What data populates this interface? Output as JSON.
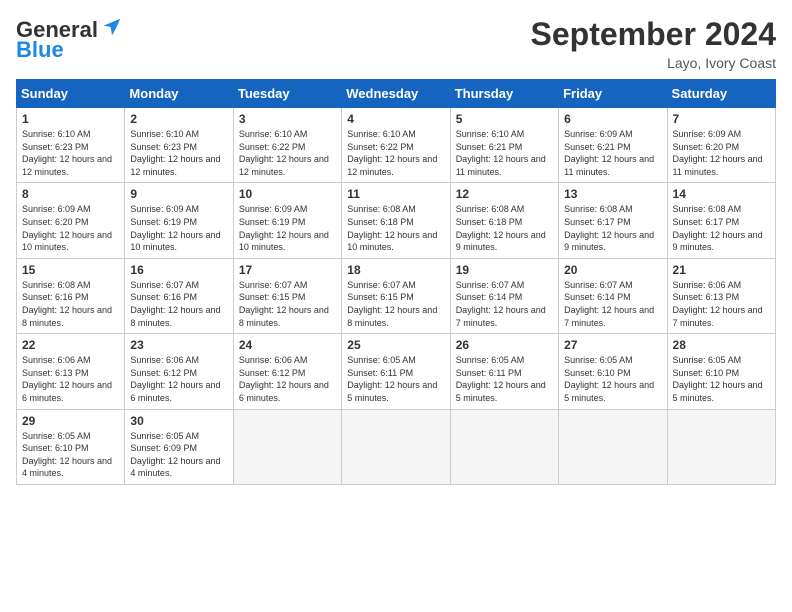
{
  "header": {
    "logo_general": "General",
    "logo_blue": "Blue",
    "month_title": "September 2024",
    "location": "Layo, Ivory Coast"
  },
  "calendar": {
    "days_of_week": [
      "Sunday",
      "Monday",
      "Tuesday",
      "Wednesday",
      "Thursday",
      "Friday",
      "Saturday"
    ],
    "weeks": [
      [
        {
          "day": "",
          "empty": true
        },
        {
          "day": "",
          "empty": true
        },
        {
          "day": "",
          "empty": true
        },
        {
          "day": "",
          "empty": true
        },
        {
          "day": "",
          "empty": true
        },
        {
          "day": "",
          "empty": true
        },
        {
          "day": "",
          "empty": true
        }
      ],
      [
        {
          "day": "1",
          "sunrise": "6:10 AM",
          "sunset": "6:23 PM",
          "daylight": "12 hours and 12 minutes."
        },
        {
          "day": "2",
          "sunrise": "6:10 AM",
          "sunset": "6:23 PM",
          "daylight": "12 hours and 12 minutes."
        },
        {
          "day": "3",
          "sunrise": "6:10 AM",
          "sunset": "6:22 PM",
          "daylight": "12 hours and 12 minutes."
        },
        {
          "day": "4",
          "sunrise": "6:10 AM",
          "sunset": "6:22 PM",
          "daylight": "12 hours and 12 minutes."
        },
        {
          "day": "5",
          "sunrise": "6:10 AM",
          "sunset": "6:21 PM",
          "daylight": "12 hours and 11 minutes."
        },
        {
          "day": "6",
          "sunrise": "6:09 AM",
          "sunset": "6:21 PM",
          "daylight": "12 hours and 11 minutes."
        },
        {
          "day": "7",
          "sunrise": "6:09 AM",
          "sunset": "6:20 PM",
          "daylight": "12 hours and 11 minutes."
        }
      ],
      [
        {
          "day": "8",
          "sunrise": "6:09 AM",
          "sunset": "6:20 PM",
          "daylight": "12 hours and 10 minutes."
        },
        {
          "day": "9",
          "sunrise": "6:09 AM",
          "sunset": "6:19 PM",
          "daylight": "12 hours and 10 minutes."
        },
        {
          "day": "10",
          "sunrise": "6:09 AM",
          "sunset": "6:19 PM",
          "daylight": "12 hours and 10 minutes."
        },
        {
          "day": "11",
          "sunrise": "6:08 AM",
          "sunset": "6:18 PM",
          "daylight": "12 hours and 10 minutes."
        },
        {
          "day": "12",
          "sunrise": "6:08 AM",
          "sunset": "6:18 PM",
          "daylight": "12 hours and 9 minutes."
        },
        {
          "day": "13",
          "sunrise": "6:08 AM",
          "sunset": "6:17 PM",
          "daylight": "12 hours and 9 minutes."
        },
        {
          "day": "14",
          "sunrise": "6:08 AM",
          "sunset": "6:17 PM",
          "daylight": "12 hours and 9 minutes."
        }
      ],
      [
        {
          "day": "15",
          "sunrise": "6:08 AM",
          "sunset": "6:16 PM",
          "daylight": "12 hours and 8 minutes."
        },
        {
          "day": "16",
          "sunrise": "6:07 AM",
          "sunset": "6:16 PM",
          "daylight": "12 hours and 8 minutes."
        },
        {
          "day": "17",
          "sunrise": "6:07 AM",
          "sunset": "6:15 PM",
          "daylight": "12 hours and 8 minutes."
        },
        {
          "day": "18",
          "sunrise": "6:07 AM",
          "sunset": "6:15 PM",
          "daylight": "12 hours and 8 minutes."
        },
        {
          "day": "19",
          "sunrise": "6:07 AM",
          "sunset": "6:14 PM",
          "daylight": "12 hours and 7 minutes."
        },
        {
          "day": "20",
          "sunrise": "6:07 AM",
          "sunset": "6:14 PM",
          "daylight": "12 hours and 7 minutes."
        },
        {
          "day": "21",
          "sunrise": "6:06 AM",
          "sunset": "6:13 PM",
          "daylight": "12 hours and 7 minutes."
        }
      ],
      [
        {
          "day": "22",
          "sunrise": "6:06 AM",
          "sunset": "6:13 PM",
          "daylight": "12 hours and 6 minutes."
        },
        {
          "day": "23",
          "sunrise": "6:06 AM",
          "sunset": "6:12 PM",
          "daylight": "12 hours and 6 minutes."
        },
        {
          "day": "24",
          "sunrise": "6:06 AM",
          "sunset": "6:12 PM",
          "daylight": "12 hours and 6 minutes."
        },
        {
          "day": "25",
          "sunrise": "6:05 AM",
          "sunset": "6:11 PM",
          "daylight": "12 hours and 5 minutes."
        },
        {
          "day": "26",
          "sunrise": "6:05 AM",
          "sunset": "6:11 PM",
          "daylight": "12 hours and 5 minutes."
        },
        {
          "day": "27",
          "sunrise": "6:05 AM",
          "sunset": "6:10 PM",
          "daylight": "12 hours and 5 minutes."
        },
        {
          "day": "28",
          "sunrise": "6:05 AM",
          "sunset": "6:10 PM",
          "daylight": "12 hours and 5 minutes."
        }
      ],
      [
        {
          "day": "29",
          "sunrise": "6:05 AM",
          "sunset": "6:10 PM",
          "daylight": "12 hours and 4 minutes."
        },
        {
          "day": "30",
          "sunrise": "6:05 AM",
          "sunset": "6:09 PM",
          "daylight": "12 hours and 4 minutes."
        },
        {
          "day": "",
          "empty": true
        },
        {
          "day": "",
          "empty": true
        },
        {
          "day": "",
          "empty": true
        },
        {
          "day": "",
          "empty": true
        },
        {
          "day": "",
          "empty": true
        }
      ]
    ]
  }
}
